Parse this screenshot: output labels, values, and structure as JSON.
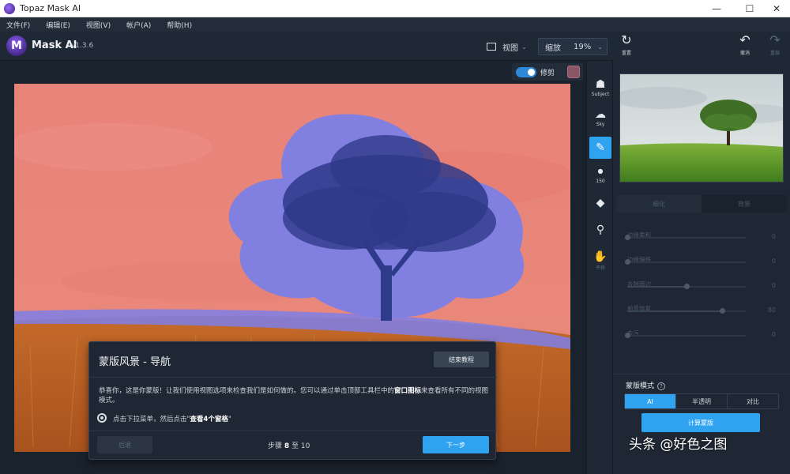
{
  "window": {
    "title": "Topaz Mask AI",
    "minimize": "—",
    "maximize": "☐",
    "close": "✕"
  },
  "menu": [
    "文件(F)",
    "编辑(E)",
    "视图(V)",
    "帐户(A)",
    "帮助(H)"
  ],
  "header": {
    "app_name": "Mask AI",
    "version": "v1.3.6",
    "view_label": "视图",
    "zoom_label": "缩放",
    "zoom_value": "19%",
    "reset_label": "重置",
    "undo_label": "撤消",
    "redo_label": "重做"
  },
  "canvas": {
    "trim_label": "修剪",
    "trim_on": true
  },
  "tools": [
    {
      "name": "subject-tool",
      "label": "Subject"
    },
    {
      "name": "sky-tool",
      "label": "Sky"
    },
    {
      "name": "brush-tool",
      "label": ""
    },
    {
      "name": "brush-size",
      "label": "150"
    },
    {
      "name": "fill-tool",
      "label": ""
    },
    {
      "name": "eyedropper-tool",
      "label": ""
    },
    {
      "name": "pan-tool",
      "label": "平移"
    }
  ],
  "tutorial": {
    "title": "蒙版风景 - 导航",
    "end_label": "结束教程",
    "body_pre": "恭喜你，这是你蒙版！让我们使用视图选项来检查我们是如何做的。您可以通过单击顶部工具栏中的",
    "body_bold": "窗口图标",
    "body_post": "来查看所有不同的视图模式。",
    "hint_pre": "点击下拉菜单，然后点击\"",
    "hint_bold": "查看4个窗格",
    "hint_post": "\"",
    "prev_label": "后退",
    "step_pre": "步骤",
    "step_current": "8",
    "step_mid": "至",
    "step_total": "10",
    "next_label": "下一步"
  },
  "panel": {
    "tabs": [
      "细化",
      "背景"
    ],
    "sliders": [
      {
        "label": "边缘柔和",
        "value": "0",
        "fraction": 0.0
      },
      {
        "label": "边缘偏移",
        "value": "0",
        "fraction": 0.0
      },
      {
        "label": "去除暗边",
        "value": "0",
        "fraction": 0.5
      },
      {
        "label": "前景恢复",
        "value": "80",
        "fraction": 0.8
      },
      {
        "label": "去污",
        "value": "0",
        "fraction": 0.0
      }
    ],
    "mask_mode_label": "蒙版模式",
    "mask_modes": [
      "AI",
      "半透明",
      "对比"
    ],
    "mask_mode_selected": "AI",
    "compute_label": "计算蒙版"
  },
  "watermark": "头条 @好色之图",
  "colors": {
    "accent": "#2fa2f0",
    "mask_background": "#e8837a",
    "mask_subject": "#7a7ae0"
  }
}
